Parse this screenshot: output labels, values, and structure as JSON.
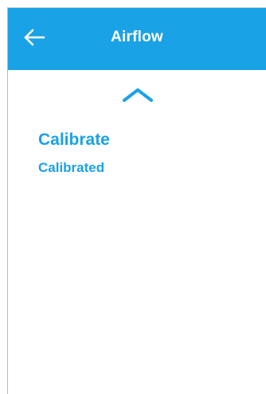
{
  "header": {
    "title": "Airflow",
    "back_icon": "arrow-left-icon",
    "background_color": "#1aa2e6"
  },
  "content": {
    "collapse_icon": "chevron-up-icon",
    "calibrate_label": "Calibrate",
    "status_text": "Calibrated",
    "accent_color": "#1aa2e6"
  }
}
